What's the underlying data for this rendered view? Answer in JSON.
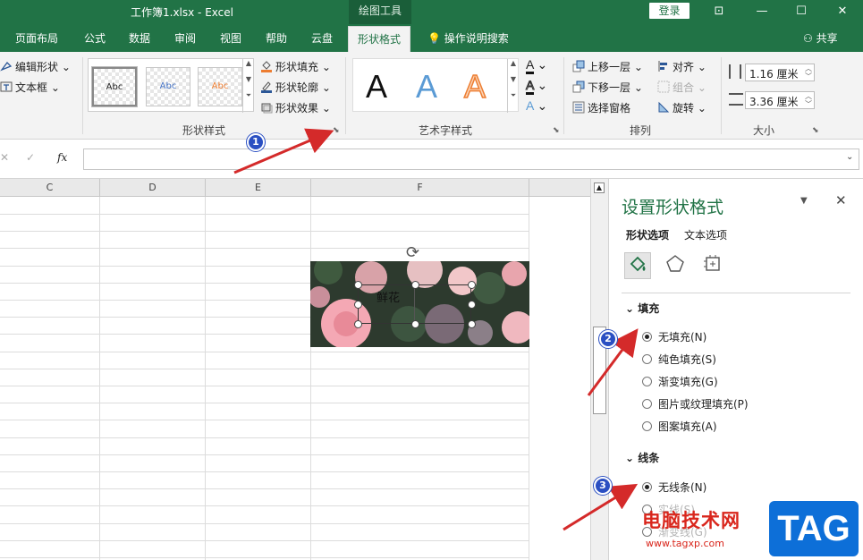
{
  "window": {
    "title": "工作簿1.xlsx  -  Excel",
    "context_tool": "绘图工具",
    "login_label": "登录",
    "minimize_icon": "—",
    "restore_icon": "☐",
    "close_icon": "✕"
  },
  "tabs": [
    {
      "label": "页面布局"
    },
    {
      "label": "公式"
    },
    {
      "label": "数据"
    },
    {
      "label": "审阅"
    },
    {
      "label": "视图"
    },
    {
      "label": "帮助"
    },
    {
      "label": "云盘"
    },
    {
      "label": "形状格式"
    },
    {
      "label": "操作说明搜索"
    }
  ],
  "share_label": "共享",
  "ribbon": {
    "insert_shapes": {
      "edit_shape": "编辑形状",
      "text_box": "文本框"
    },
    "shape_styles": {
      "thumb_label": "Abc",
      "fill": "形状填充",
      "outline": "形状轮廓",
      "effects": "形状效果",
      "group_label": "形状样式"
    },
    "wordart": {
      "letter": "A",
      "group_label": "艺术字样式"
    },
    "arrange": {
      "bring_forward": "上移一层",
      "send_backward": "下移一层",
      "selection_pane": "选择窗格",
      "align": "对齐",
      "group": "组合",
      "rotate": "旋转",
      "group_label": "排列"
    },
    "size": {
      "height": "1.16 厘米",
      "width": "3.36 厘米",
      "group_label": "大小"
    }
  },
  "formula_bar": {
    "fx_label": "fx",
    "value": ""
  },
  "sheet": {
    "columns": [
      "C",
      "D",
      "E",
      "F"
    ],
    "textbox_text": "鲜花"
  },
  "pane": {
    "title": "设置形状格式",
    "tabs": [
      "形状选项",
      "文本选项"
    ],
    "fill_section": "填充",
    "fill_options": [
      {
        "label": "无填充(N)",
        "checked": true
      },
      {
        "label": "纯色填充(S)",
        "checked": false
      },
      {
        "label": "渐变填充(G)",
        "checked": false
      },
      {
        "label": "图片或纹理填充(P)",
        "checked": false
      },
      {
        "label": "图案填充(A)",
        "checked": false
      }
    ],
    "line_section": "线条",
    "line_options": [
      {
        "label": "无线条(N)",
        "checked": true
      },
      {
        "label": "实线(S)",
        "checked": false
      },
      {
        "label": "渐变线(G)",
        "checked": false
      }
    ]
  },
  "badges": [
    "1",
    "2",
    "3"
  ],
  "watermark": {
    "text": "电脑技术网",
    "url": "www.tagxp.com",
    "logo": "TAG"
  },
  "colors": {
    "excel_green": "#217346",
    "arrow_red": "#d42a2a",
    "badge_blue": "#2a4fc2"
  }
}
